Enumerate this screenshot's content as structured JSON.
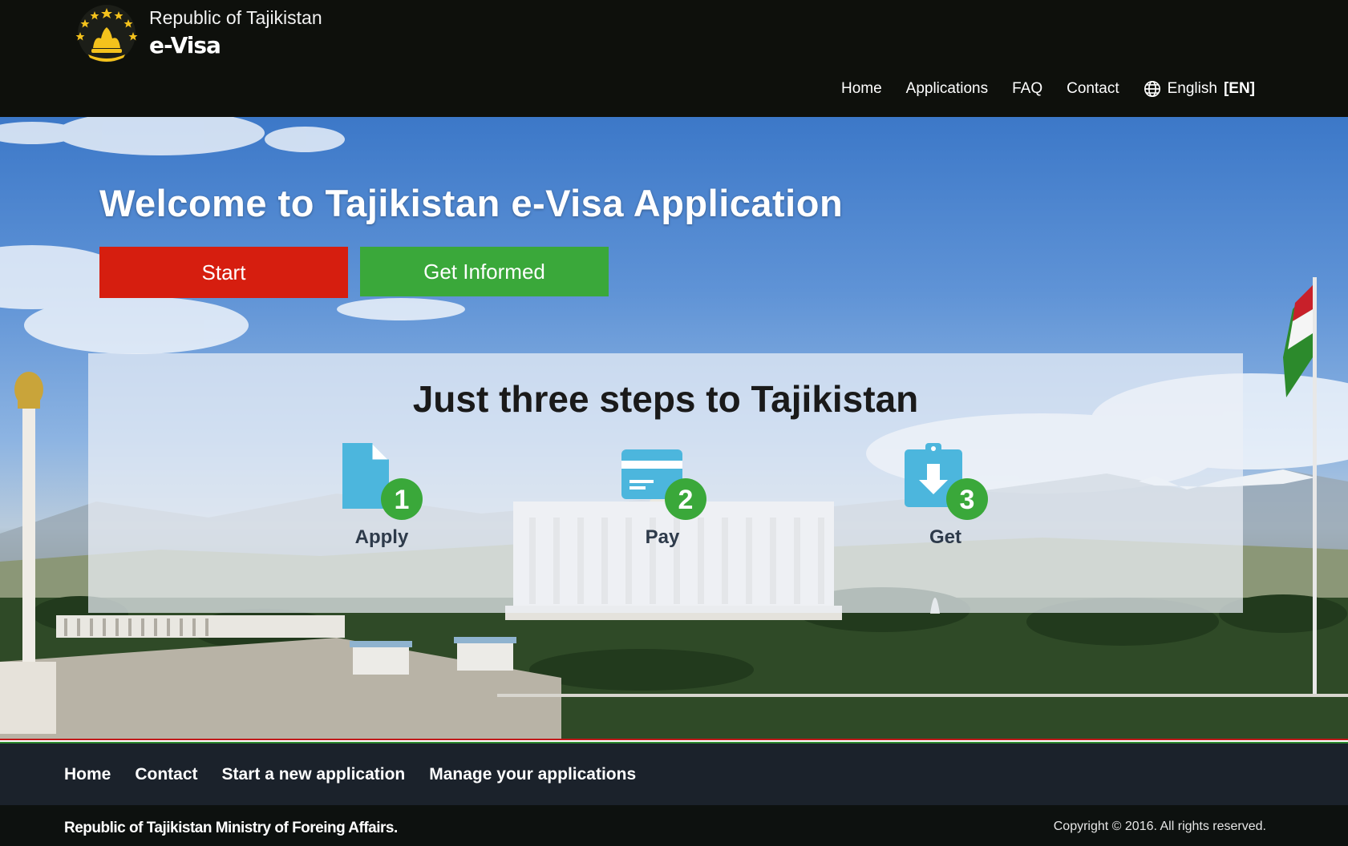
{
  "header": {
    "country": "Republic of Tajikistan",
    "product": "e-Visa",
    "emblem_icon": "tajik-crown-emblem-icon",
    "nav": [
      {
        "label": "Home"
      },
      {
        "label": "Applications"
      },
      {
        "label": "FAQ"
      },
      {
        "label": "Contact"
      }
    ],
    "language": {
      "icon": "globe-icon",
      "name": "English",
      "code": "[EN]"
    }
  },
  "hero": {
    "title": "Welcome to Tajikistan e-Visa Application",
    "start_label": "Start",
    "info_label": "Get Informed",
    "steps_title": "Just three steps to Tajikistan",
    "steps": [
      {
        "number": "1",
        "label": "Apply",
        "icon": "document-icon"
      },
      {
        "number": "2",
        "label": "Pay",
        "icon": "credit-card-icon"
      },
      {
        "number": "3",
        "label": "Get",
        "icon": "clipboard-download-icon"
      }
    ]
  },
  "footer": {
    "nav": [
      {
        "label": "Home"
      },
      {
        "label": "Contact"
      },
      {
        "label": "Start a new application"
      },
      {
        "label": "Manage your applications"
      }
    ],
    "organization": "Republic of Tajikistan Ministry of Foreing Affairs.",
    "copyright": "Copyright © 2016. All rights reserved."
  },
  "colors": {
    "header_bg": "#0e100c",
    "start_button": "#d61e0f",
    "info_button": "#3aa83a",
    "step_icon": "#4cb6dd",
    "step_badge": "#3aa83a",
    "footer_bg": "#1b222b"
  }
}
